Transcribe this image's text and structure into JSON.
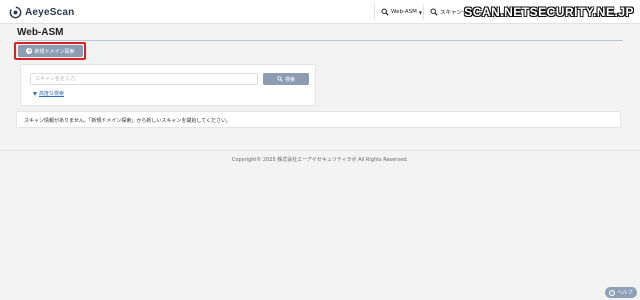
{
  "app": {
    "logo_text": "AeyeScan"
  },
  "nav": {
    "asm_label": "Web-ASM",
    "scan_label": "スキャン一覧"
  },
  "watermark": "SCAN.NETSECURITY.NE.JP",
  "page": {
    "title": "Web-ASM",
    "new_search_button": "新規ドメイン探索"
  },
  "search": {
    "placeholder": "スキャン名を入力",
    "value": "",
    "button_label": "検索",
    "advanced_link": "高度な検索"
  },
  "message": "スキャン情報がありません。「新規ドメイン探索」から新しいスキャンを開始してください。",
  "footer": {
    "copyright": "Copyright© 2025 株式会社エーアイセキュリティラボ All Rights Reserved."
  },
  "help": {
    "label": "ヘルプ"
  },
  "colors": {
    "accent_button": "#8c9db3",
    "highlight_border": "#e02020",
    "link": "#2c6fb2"
  }
}
